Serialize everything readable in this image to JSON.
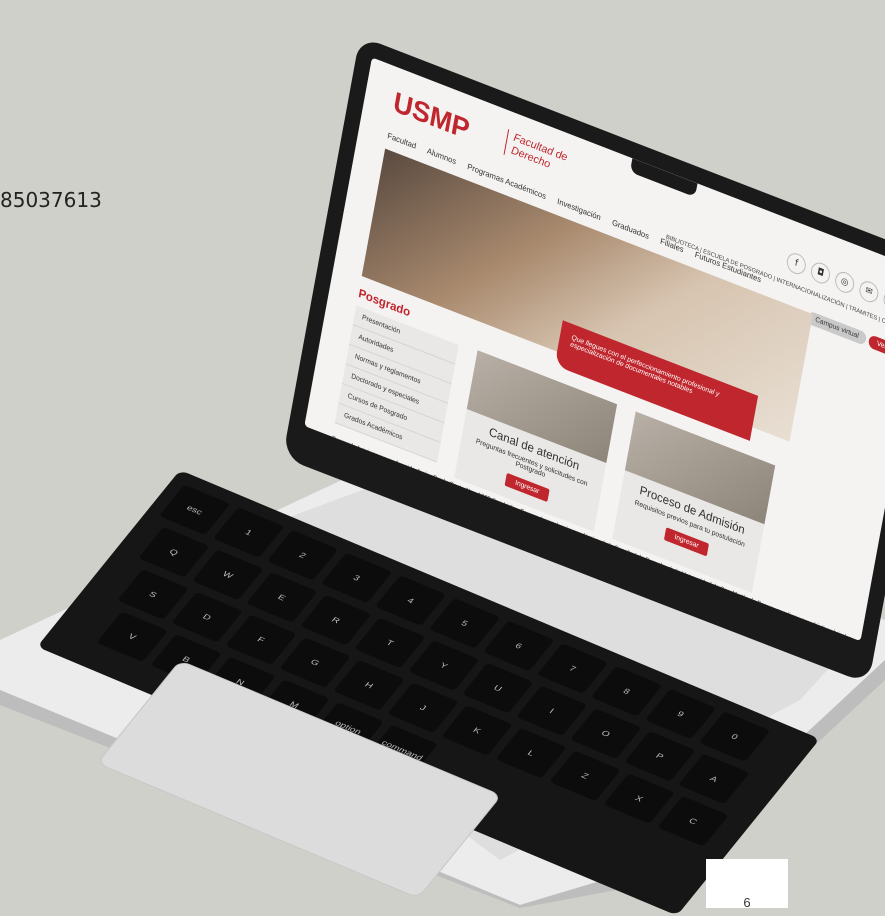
{
  "phone_fragment": "85037613",
  "page_number": "6",
  "site": {
    "logo": "USMP",
    "logo_sub": "Facultad de Derecho",
    "nav": [
      "Facultad",
      "Alumnos",
      "Programas Académicos",
      "Investigación",
      "Graduados",
      "Filiales",
      "Futuros Estudiantes"
    ],
    "top_links": "BIBLIOTECA | ESCUELA DE POSGRADO | INTERNACIONALIZACIÓN | TRÁMITES | CARPETA",
    "socials": [
      "f",
      "◘",
      "◎",
      "✉",
      "@"
    ],
    "campus_button": "Campus virtual",
    "red_button": "Ver",
    "hero_band": "Que llegues con el perfeccionamiento profesional y especialización de documentales notables",
    "section_title": "Posgrado",
    "side_menu": [
      "Presentación",
      "Autoridades",
      "Normas y reglamentos",
      "Doctorado y especiales",
      "Cursos de Posgrado",
      "Grados Académicos"
    ],
    "cards": [
      {
        "title": "Canal de atención",
        "subtitle": "Preguntas frecuentes y solicitudes con Postgrado",
        "button": "Ingresar"
      },
      {
        "title": "Proceso de Admisión",
        "subtitle": "Requisitos previos para tu postulación",
        "button": "Ingresar"
      }
    ],
    "description": "Posgrado funciona en su Avenida Javier Prado Oeste Nro. 1080 San Isidro. Es una dependencia académica de la Facultad de Derecho de la Universidad de San Martín de Porres, que tiene por objetivo: brindar formación de profesionales con estudios de Maestría y Doctorado"
  },
  "keyboard": [
    "esc",
    "1",
    "2",
    "3",
    "4",
    "5",
    "6",
    "7",
    "8",
    "9",
    "0",
    "Q",
    "W",
    "E",
    "R",
    "T",
    "Y",
    "U",
    "I",
    "O",
    "P",
    "A",
    "S",
    "D",
    "F",
    "G",
    "H",
    "J",
    "K",
    "L",
    "Z",
    "X",
    "C",
    "V",
    "B",
    "N",
    "M",
    "option",
    "command"
  ]
}
